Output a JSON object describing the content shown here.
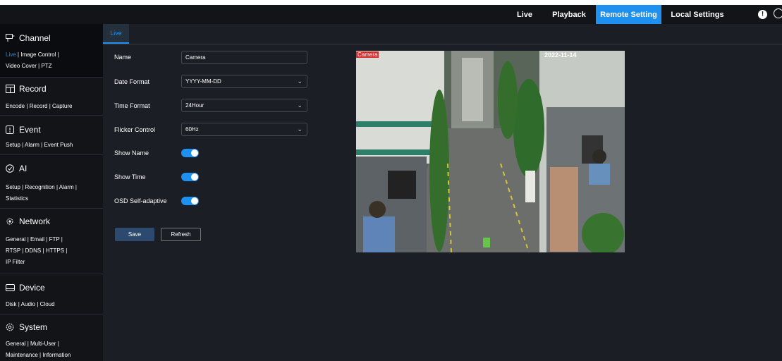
{
  "topnav": {
    "items": [
      {
        "label": "Live"
      },
      {
        "label": "Playback"
      },
      {
        "label": "Remote Setting",
        "active": true
      },
      {
        "label": "Local Settings"
      }
    ]
  },
  "sidebar": {
    "channel": {
      "title": "Channel",
      "links": [
        "Live",
        "Image Control",
        "Video Cover",
        "PTZ"
      ]
    },
    "record": {
      "title": "Record",
      "links": [
        "Encode",
        "Record",
        "Capture"
      ]
    },
    "event": {
      "title": "Event",
      "links": [
        "Setup",
        "Alarm",
        "Event Push"
      ]
    },
    "ai": {
      "title": "AI",
      "links": [
        "Setup",
        "Recognition",
        "Alarm",
        "Statistics"
      ]
    },
    "network": {
      "title": "Network",
      "links": [
        "General",
        "Email",
        "FTP",
        "RTSP",
        "DDNS",
        "HTTPS",
        "IP Filter"
      ]
    },
    "device": {
      "title": "Device",
      "links": [
        "Disk",
        "Audio",
        "Cloud"
      ]
    },
    "system": {
      "title": "System",
      "links": [
        "General",
        "Multi-User",
        "Maintenance",
        "Information"
      ]
    },
    "separator": "|"
  },
  "main": {
    "tab": "Live",
    "form": {
      "name_label": "Name",
      "name_value": "Camera",
      "date_format_label": "Date Format",
      "date_format_value": "YYYY-MM-DD",
      "time_format_label": "Time Format",
      "time_format_value": "24Hour",
      "flicker_label": "Flicker Control",
      "flicker_value": "60Hz",
      "show_name_label": "Show Name",
      "show_name_on": true,
      "show_time_label": "Show Time",
      "show_time_on": true,
      "osd_label": "OSD Self-adaptive",
      "osd_on": true
    },
    "save_label": "Save",
    "refresh_label": "Refresh",
    "preview": {
      "osd_name": "Camera",
      "osd_time": "2022-11-14"
    }
  },
  "icons": {
    "alert": "alert-icon",
    "power": "power-icon"
  },
  "colors": {
    "accent": "#1e90ef",
    "sidebar_bg": "#121418",
    "main_bg": "#1b1e24"
  }
}
